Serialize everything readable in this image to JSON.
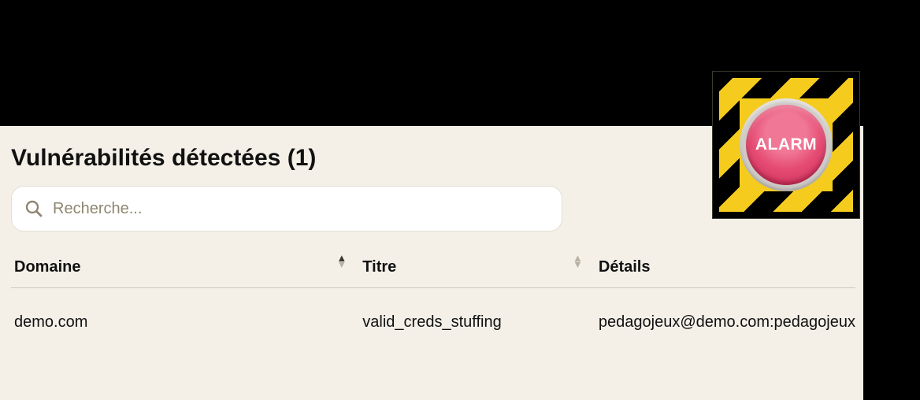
{
  "panel": {
    "title": "Vulnérabilités détectées (1)"
  },
  "search": {
    "placeholder": "Recherche..."
  },
  "table": {
    "headers": {
      "domain": "Domaine",
      "title": "Titre",
      "details": "Détails"
    },
    "rows": [
      {
        "domain": "demo.com",
        "title": "valid_creds_stuffing",
        "details": "pedagojeux@demo.com:pedagojeux"
      }
    ]
  },
  "alarm": {
    "label": "ALARM"
  }
}
